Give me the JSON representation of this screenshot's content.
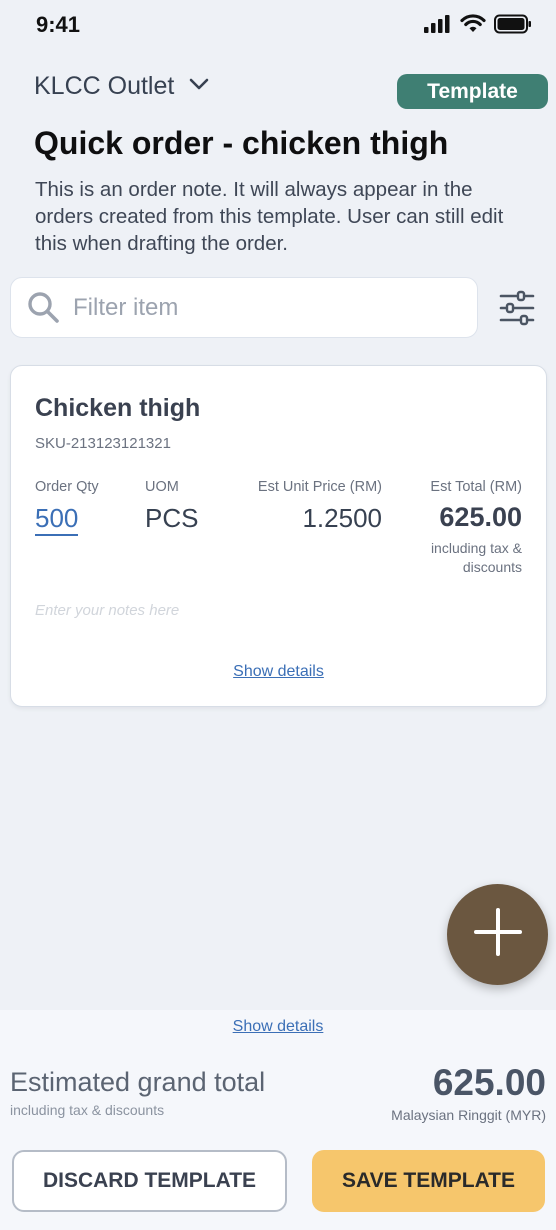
{
  "status_bar": {
    "time": "9:41",
    "icons": [
      "signal-icon",
      "wifi-icon",
      "battery-icon"
    ]
  },
  "header": {
    "outlet_name": "KLCC Outlet",
    "outlet_dropdown_icon": "chevron-down-icon",
    "badge_label": "Template",
    "title": "Quick order - chicken thigh",
    "order_note": "This is an order note. It will always appear in the orders created from this template. User can still edit this when drafting the order."
  },
  "search": {
    "placeholder": "Filter item",
    "value": "",
    "icon": "search-icon",
    "filter_icon": "sliders-icon"
  },
  "items": [
    {
      "name": "Chicken thigh",
      "sku": "SKU-213123121321",
      "labels": {
        "qty": "Order Qty",
        "uom": "UOM",
        "unit_price": "Est Unit Price (RM)",
        "total": "Est Total (RM)"
      },
      "qty": "500",
      "uom": "PCS",
      "unit_price": "1.2500",
      "total": "625.00",
      "total_note": "including tax & discounts",
      "notes_placeholder": "Enter your notes here",
      "show_details": "Show details"
    }
  ],
  "fab_icon": "plus-icon",
  "summary": {
    "show_details": "Show details",
    "grand_total_label": "Estimated grand total",
    "grand_total_sub": "including tax & discounts",
    "grand_total_value": "625.00",
    "currency_label": "Malaysian Ringgit (MYR)"
  },
  "actions": {
    "discard_label": "DISCARD TEMPLATE",
    "save_label": "SAVE TEMPLATE"
  },
  "colors": {
    "accent_badge": "#3f7f73",
    "link": "#3b6fb6",
    "fab": "#6b5740",
    "save_button": "#f6c66c",
    "background": "#eef1f6"
  }
}
